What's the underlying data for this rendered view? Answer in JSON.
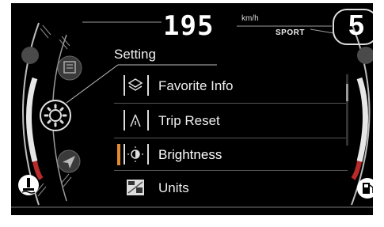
{
  "header": {
    "speed": "195",
    "speed_unit": "km/h",
    "drive_mode": "SPORT",
    "gear": "5"
  },
  "menu": {
    "title": "Setting",
    "items": [
      {
        "label": "Favorite Info",
        "icon": "layers-icon"
      },
      {
        "label": "Trip Reset",
        "icon": "trip-reset-icon"
      },
      {
        "label": "Brightness",
        "icon": "brightness-icon"
      },
      {
        "label": "Units",
        "icon": "units-icon"
      }
    ],
    "selected_index": 2
  },
  "rail_icons": [
    "media-icon",
    "settings-icon",
    "navigation-icon"
  ],
  "gauges": {
    "left": "temperature-icon",
    "right": "fuel-icon"
  },
  "colors": {
    "background": "#000000",
    "text": "#eeeeee",
    "accent": "#e48a2e"
  }
}
